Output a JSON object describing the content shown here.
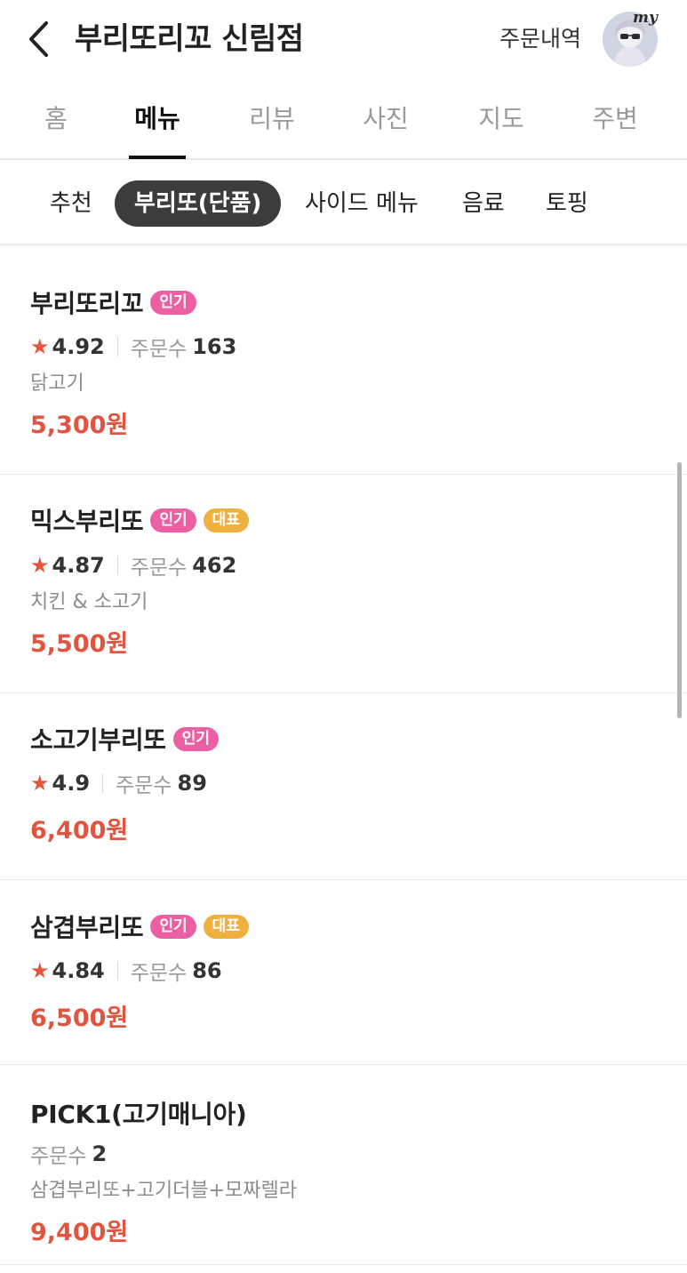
{
  "header": {
    "store_name": "부리또리꼬 신림점",
    "order_history": "주문내역",
    "my_badge": "my"
  },
  "main_tabs": [
    {
      "label": "홈",
      "active": false
    },
    {
      "label": "메뉴",
      "active": true
    },
    {
      "label": "리뷰",
      "active": false
    },
    {
      "label": "사진",
      "active": false
    },
    {
      "label": "지도",
      "active": false
    },
    {
      "label": "주변",
      "active": false
    }
  ],
  "categories": [
    {
      "label": "추천",
      "active": false
    },
    {
      "label": "부리또(단품)",
      "active": true
    },
    {
      "label": "사이드 메뉴",
      "active": false
    },
    {
      "label": "음료",
      "active": false
    },
    {
      "label": "토핑",
      "active": false
    }
  ],
  "badges": {
    "popular": "인기",
    "signature": "대표"
  },
  "orders_label": "주문수",
  "menu_items": [
    {
      "name": "부리또리꼬",
      "badges": [
        "popular"
      ],
      "rating": "4.92",
      "orders": "163",
      "description": "닭고기",
      "price": "5,300원"
    },
    {
      "name": "믹스부리또",
      "badges": [
        "popular",
        "signature"
      ],
      "rating": "4.87",
      "orders": "462",
      "description": "치킨 & 소고기",
      "price": "5,500원"
    },
    {
      "name": "소고기부리또",
      "badges": [
        "popular"
      ],
      "rating": "4.9",
      "orders": "89",
      "description": "",
      "price": "6,400원"
    },
    {
      "name": "삼겹부리또",
      "badges": [
        "popular",
        "signature"
      ],
      "rating": "4.84",
      "orders": "86",
      "description": "",
      "price": "6,500원"
    },
    {
      "name": "PICK1(고기매니아)",
      "badges": [],
      "rating": "",
      "orders": "2",
      "description": "삼겹부리또+고기더블+모짜렐라",
      "price": "9,400원"
    }
  ],
  "colors": {
    "price": "#e0553f",
    "popular_badge": "#ec5fa2",
    "signature_badge": "#f0b03f",
    "active_chip": "#3c3c3c",
    "star": "#e8553c"
  },
  "icons": {
    "back": "chevron-left-icon",
    "rating": "star-icon"
  }
}
